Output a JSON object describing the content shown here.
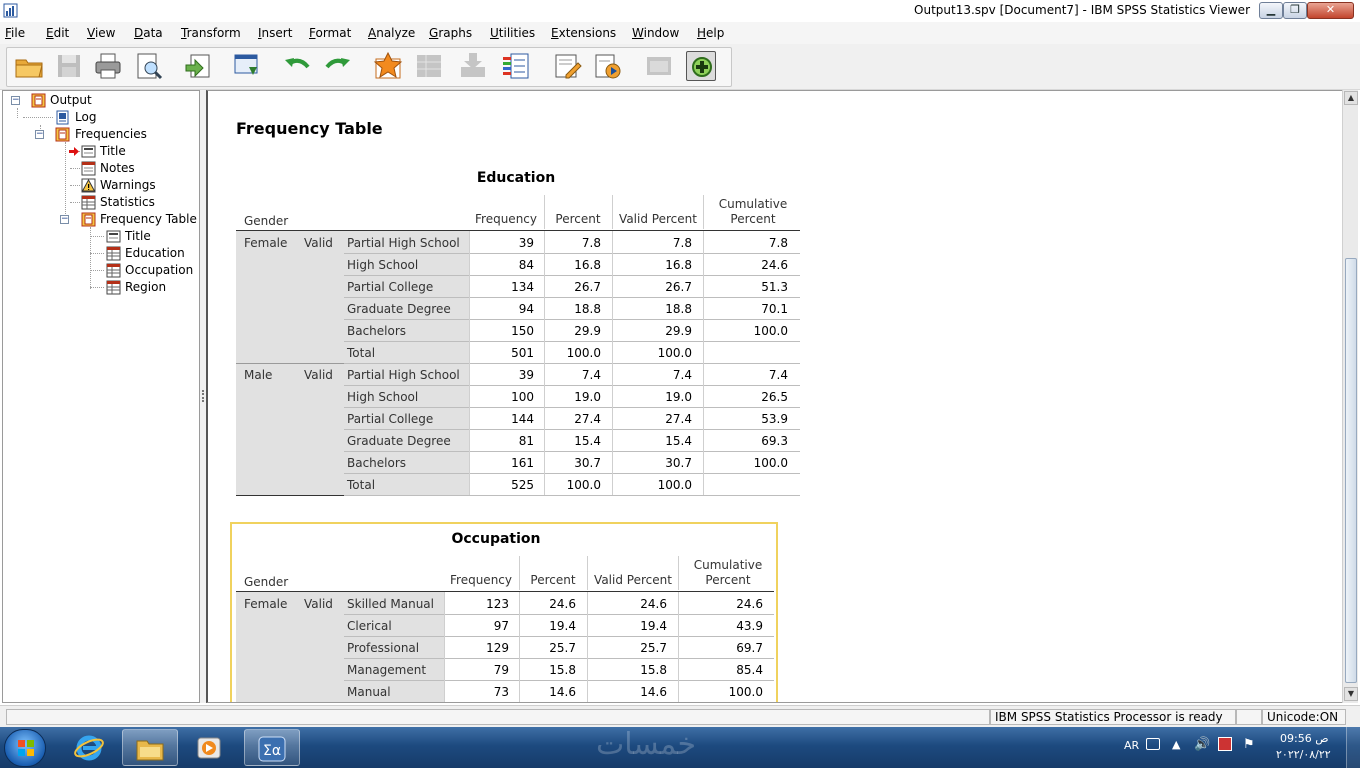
{
  "window": {
    "title": "Output13.spv [Document7] - IBM SPSS Statistics Viewer",
    "minimize": "▁",
    "maximize": "❐",
    "close": "✕"
  },
  "menu": [
    "File",
    "Edit",
    "View",
    "Data",
    "Transform",
    "Insert",
    "Format",
    "Analyze",
    "Graphs",
    "Utilities",
    "Extensions",
    "Window",
    "Help"
  ],
  "outline": {
    "nodes": {
      "output": "Output",
      "log": "Log",
      "frequencies": "Frequencies",
      "title": "Title",
      "notes": "Notes",
      "warnings": "Warnings",
      "statistics": "Statistics",
      "frequency_table": "Frequency Table",
      "ft_title": "Title",
      "education": "Education",
      "occupation": "Occupation",
      "region": "Region"
    },
    "toggle_expanded": "−"
  },
  "content": {
    "section_title": "Frequency Table",
    "education": {
      "caption": "Education",
      "headers": {
        "gender": "Gender",
        "frequency": "Frequency",
        "percent": "Percent",
        "valid_percent": "Valid Percent",
        "cumulative_1": "Cumulative",
        "cumulative_2": "Percent"
      },
      "groups": [
        {
          "gender": "Female",
          "valid": "Valid",
          "rows": [
            {
              "label": "Partial High School",
              "freq": "39",
              "pct": "7.8",
              "vpct": "7.8",
              "cum": "7.8"
            },
            {
              "label": "High School",
              "freq": "84",
              "pct": "16.8",
              "vpct": "16.8",
              "cum": "24.6"
            },
            {
              "label": "Partial College",
              "freq": "134",
              "pct": "26.7",
              "vpct": "26.7",
              "cum": "51.3"
            },
            {
              "label": "Graduate Degree",
              "freq": "94",
              "pct": "18.8",
              "vpct": "18.8",
              "cum": "70.1"
            },
            {
              "label": "Bachelors",
              "freq": "150",
              "pct": "29.9",
              "vpct": "29.9",
              "cum": "100.0"
            },
            {
              "label": "Total",
              "freq": "501",
              "pct": "100.0",
              "vpct": "100.0",
              "cum": ""
            }
          ]
        },
        {
          "gender": "Male",
          "valid": "Valid",
          "rows": [
            {
              "label": "Partial High School",
              "freq": "39",
              "pct": "7.4",
              "vpct": "7.4",
              "cum": "7.4"
            },
            {
              "label": "High School",
              "freq": "100",
              "pct": "19.0",
              "vpct": "19.0",
              "cum": "26.5"
            },
            {
              "label": "Partial College",
              "freq": "144",
              "pct": "27.4",
              "vpct": "27.4",
              "cum": "53.9"
            },
            {
              "label": "Graduate Degree",
              "freq": "81",
              "pct": "15.4",
              "vpct": "15.4",
              "cum": "69.3"
            },
            {
              "label": "Bachelors",
              "freq": "161",
              "pct": "30.7",
              "vpct": "30.7",
              "cum": "100.0"
            },
            {
              "label": "Total",
              "freq": "525",
              "pct": "100.0",
              "vpct": "100.0",
              "cum": ""
            }
          ]
        }
      ]
    },
    "occupation": {
      "caption": "Occupation",
      "headers": {
        "gender": "Gender",
        "frequency": "Frequency",
        "percent": "Percent",
        "valid_percent": "Valid Percent",
        "cumulative_1": "Cumulative",
        "cumulative_2": "Percent"
      },
      "groups": [
        {
          "gender": "Female",
          "valid": "Valid",
          "rows": [
            {
              "label": "Skilled Manual",
              "freq": "123",
              "pct": "24.6",
              "vpct": "24.6",
              "cum": "24.6"
            },
            {
              "label": "Clerical",
              "freq": "97",
              "pct": "19.4",
              "vpct": "19.4",
              "cum": "43.9"
            },
            {
              "label": "Professional",
              "freq": "129",
              "pct": "25.7",
              "vpct": "25.7",
              "cum": "69.7"
            },
            {
              "label": "Management",
              "freq": "79",
              "pct": "15.8",
              "vpct": "15.8",
              "cum": "85.4"
            },
            {
              "label": "Manual",
              "freq": "73",
              "pct": "14.6",
              "vpct": "14.6",
              "cum": "100.0"
            }
          ]
        }
      ]
    }
  },
  "status": {
    "processor": "IBM SPSS Statistics Processor is ready",
    "unicode": "Unicode:ON"
  },
  "taskbar": {
    "watermark": "خمسات",
    "language": "AR",
    "time": "09:56 ص",
    "date": "٢٠٢٢/٠٨/٢٢"
  },
  "icons": {
    "toolbar": [
      "open-folder-icon",
      "save-icon",
      "print-icon",
      "print-preview-icon",
      "export-icon",
      "recall-dialog-icon",
      "undo-icon",
      "redo-icon",
      "go-to-data-icon",
      "go-to-case-icon",
      "go-to-variable-icon",
      "variables-icon",
      "create-script-icon",
      "run-script-icon",
      "designate-window-icon",
      "add-extension-icon"
    ]
  },
  "colors": {
    "row_shade": "#e1e1e1",
    "selection_frame": "#f0d25e",
    "taskbar": "#1d4a7f"
  }
}
